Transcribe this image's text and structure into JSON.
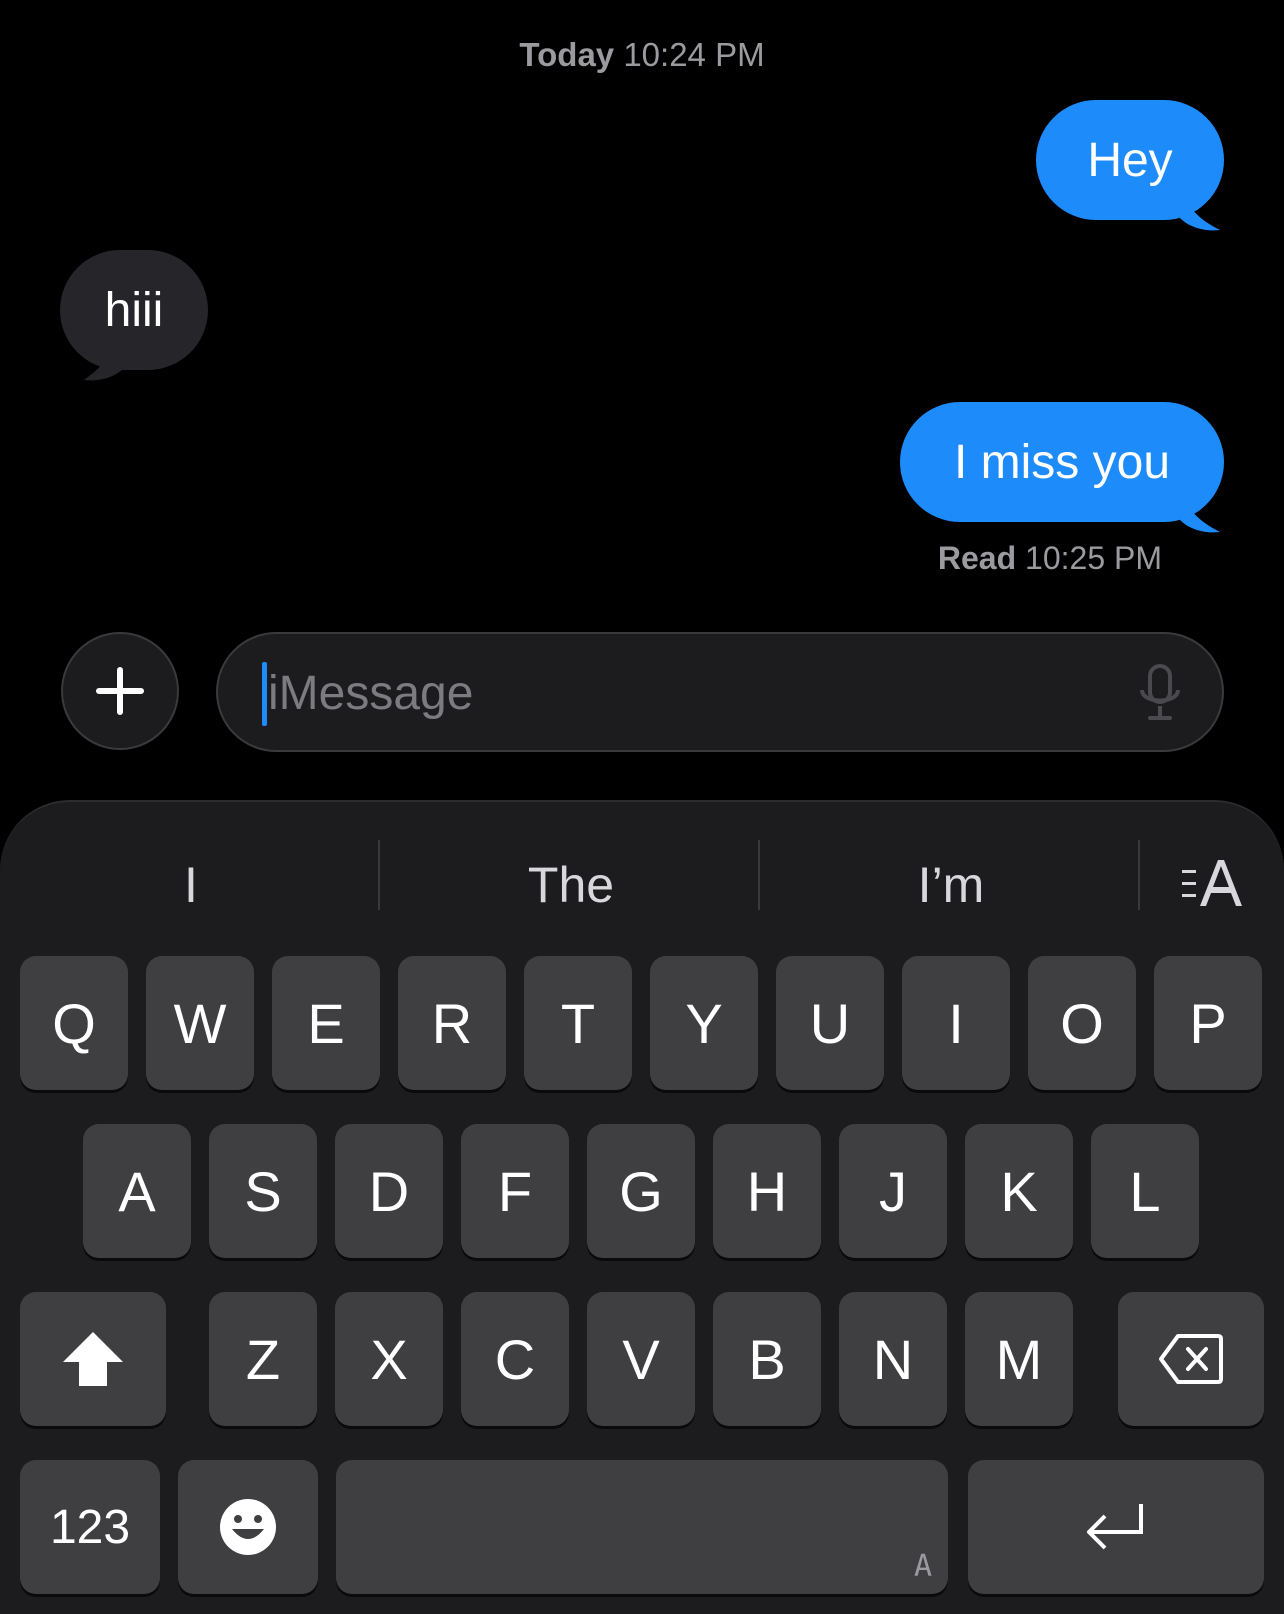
{
  "conversation": {
    "timestamp_day": "Today",
    "timestamp_time": "10:24 PM",
    "messages": [
      {
        "direction": "out",
        "text": "Hey"
      },
      {
        "direction": "in",
        "text": "hiii"
      },
      {
        "direction": "out",
        "text": "I miss you"
      }
    ],
    "read_label": "Read",
    "read_time": "10:25 PM"
  },
  "composer": {
    "placeholder": "iMessage",
    "plus_icon": "plus-icon",
    "mic_icon": "microphone-icon"
  },
  "keyboard": {
    "suggestions": [
      "I",
      "The",
      "I’m"
    ],
    "row1": [
      "Q",
      "W",
      "E",
      "R",
      "T",
      "Y",
      "U",
      "I",
      "O",
      "P"
    ],
    "row2": [
      "A",
      "S",
      "D",
      "F",
      "G",
      "H",
      "J",
      "K",
      "L"
    ],
    "row3": [
      "Z",
      "X",
      "C",
      "V",
      "B",
      "N",
      "M"
    ],
    "numbers_label": "123",
    "space_mark": "A"
  },
  "colors": {
    "outgoing_bubble": "#1e8bfa",
    "incoming_bubble": "#26252a",
    "background": "#000000",
    "keyboard_bg": "#1c1c1e",
    "key_bg": "#3f3f42"
  }
}
